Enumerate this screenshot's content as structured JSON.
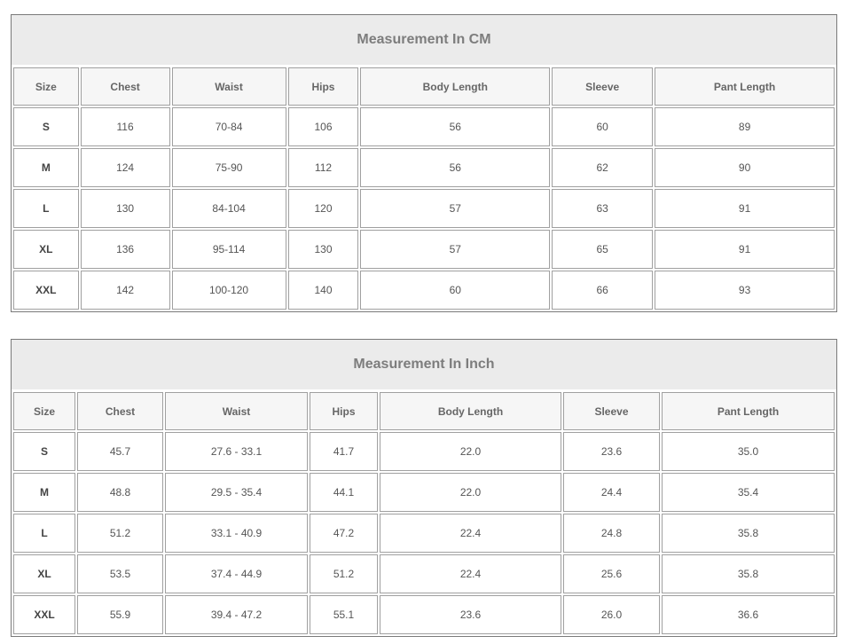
{
  "tables": [
    {
      "title": "Measurement In CM",
      "headers": [
        "Size",
        "Chest",
        "Waist",
        "Hips",
        "Body Length",
        "Sleeve",
        "Pant Length"
      ],
      "rows": [
        [
          "S",
          "116",
          "70-84",
          "106",
          "56",
          "60",
          "89"
        ],
        [
          "M",
          "124",
          "75-90",
          "112",
          "56",
          "62",
          "90"
        ],
        [
          "L",
          "130",
          "84-104",
          "120",
          "57",
          "63",
          "91"
        ],
        [
          "XL",
          "136",
          "95-114",
          "130",
          "57",
          "65",
          "91"
        ],
        [
          "XXL",
          "142",
          "100-120",
          "140",
          "60",
          "66",
          "93"
        ]
      ]
    },
    {
      "title": "Measurement In Inch",
      "headers": [
        "Size",
        "Chest",
        "Waist",
        "Hips",
        "Body Length",
        "Sleeve",
        "Pant Length"
      ],
      "rows": [
        [
          "S",
          "45.7",
          "27.6 - 33.1",
          "41.7",
          "22.0",
          "23.6",
          "35.0"
        ],
        [
          "M",
          "48.8",
          "29.5 - 35.4",
          "44.1",
          "22.0",
          "24.4",
          "35.4"
        ],
        [
          "L",
          "51.2",
          "33.1 - 40.9",
          "47.2",
          "22.4",
          "24.8",
          "35.8"
        ],
        [
          "XL",
          "53.5",
          "37.4 - 44.9",
          "51.2",
          "22.4",
          "25.6",
          "35.8"
        ],
        [
          "XXL",
          "55.9",
          "39.4 - 47.2",
          "55.1",
          "23.6",
          "26.0",
          "36.6"
        ]
      ]
    }
  ]
}
